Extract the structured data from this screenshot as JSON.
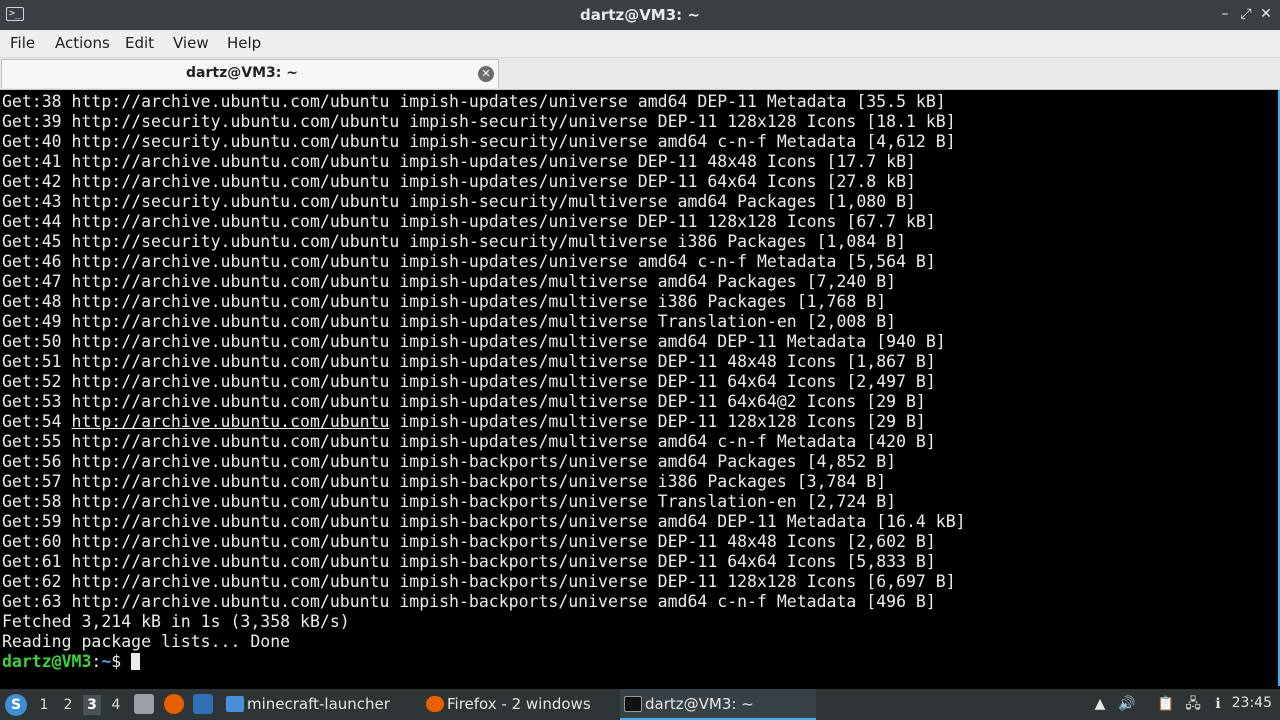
{
  "window": {
    "title": "dartz@VM3: ~",
    "app_icon_glyph": ">_",
    "minimize_glyph": "–",
    "maximize_glyph": "⤢",
    "close_glyph": "✕"
  },
  "menu": {
    "items": [
      "File",
      "Actions",
      "Edit",
      "View",
      "Help"
    ]
  },
  "tabs": [
    {
      "label": "dartz@VM3: ~",
      "close_glyph": "✕"
    }
  ],
  "terminal": {
    "lines": [
      {
        "pre": "Get:38 ",
        "url": "http://archive.ubuntu.com/ubuntu",
        "post": " impish-updates/universe amd64 DEP-11 Metadata [35.5 kB]"
      },
      {
        "pre": "Get:39 ",
        "url": "http://security.ubuntu.com/ubuntu",
        "post": " impish-security/universe DEP-11 128x128 Icons [18.1 kB]"
      },
      {
        "pre": "Get:40 ",
        "url": "http://security.ubuntu.com/ubuntu",
        "post": " impish-security/universe amd64 c-n-f Metadata [4,612 B]"
      },
      {
        "pre": "Get:41 ",
        "url": "http://archive.ubuntu.com/ubuntu",
        "post": " impish-updates/universe DEP-11 48x48 Icons [17.7 kB]"
      },
      {
        "pre": "Get:42 ",
        "url": "http://archive.ubuntu.com/ubuntu",
        "post": " impish-updates/universe DEP-11 64x64 Icons [27.8 kB]"
      },
      {
        "pre": "Get:43 ",
        "url": "http://security.ubuntu.com/ubuntu",
        "post": " impish-security/multiverse amd64 Packages [1,080 B]"
      },
      {
        "pre": "Get:44 ",
        "url": "http://archive.ubuntu.com/ubuntu",
        "post": " impish-updates/universe DEP-11 128x128 Icons [67.7 kB]"
      },
      {
        "pre": "Get:45 ",
        "url": "http://security.ubuntu.com/ubuntu",
        "post": " impish-security/multiverse i386 Packages [1,084 B]"
      },
      {
        "pre": "Get:46 ",
        "url": "http://archive.ubuntu.com/ubuntu",
        "post": " impish-updates/universe amd64 c-n-f Metadata [5,564 B]"
      },
      {
        "pre": "Get:47 ",
        "url": "http://archive.ubuntu.com/ubuntu",
        "post": " impish-updates/multiverse amd64 Packages [7,240 B]"
      },
      {
        "pre": "Get:48 ",
        "url": "http://archive.ubuntu.com/ubuntu",
        "post": " impish-updates/multiverse i386 Packages [1,768 B]"
      },
      {
        "pre": "Get:49 ",
        "url": "http://archive.ubuntu.com/ubuntu",
        "post": " impish-updates/multiverse Translation-en [2,008 B]"
      },
      {
        "pre": "Get:50 ",
        "url": "http://archive.ubuntu.com/ubuntu",
        "post": " impish-updates/multiverse amd64 DEP-11 Metadata [940 B]"
      },
      {
        "pre": "Get:51 ",
        "url": "http://archive.ubuntu.com/ubuntu",
        "post": " impish-updates/multiverse DEP-11 48x48 Icons [1,867 B]"
      },
      {
        "pre": "Get:52 ",
        "url": "http://archive.ubuntu.com/ubuntu",
        "post": " impish-updates/multiverse DEP-11 64x64 Icons [2,497 B]"
      },
      {
        "pre": "Get:53 ",
        "url": "http://archive.ubuntu.com/ubuntu",
        "post": " impish-updates/multiverse DEP-11 64x64@2 Icons [29 B]"
      },
      {
        "pre": "Get:54 ",
        "url": "http://archive.ubuntu.com/ubuntu",
        "post": " impish-updates/multiverse DEP-11 128x128 Icons [29 B]",
        "hovered": true
      },
      {
        "pre": "Get:55 ",
        "url": "http://archive.ubuntu.com/ubuntu",
        "post": " impish-updates/multiverse amd64 c-n-f Metadata [420 B]"
      },
      {
        "pre": "Get:56 ",
        "url": "http://archive.ubuntu.com/ubuntu",
        "post": " impish-backports/universe amd64 Packages [4,852 B]"
      },
      {
        "pre": "Get:57 ",
        "url": "http://archive.ubuntu.com/ubuntu",
        "post": " impish-backports/universe i386 Packages [3,784 B]"
      },
      {
        "pre": "Get:58 ",
        "url": "http://archive.ubuntu.com/ubuntu",
        "post": " impish-backports/universe Translation-en [2,724 B]"
      },
      {
        "pre": "Get:59 ",
        "url": "http://archive.ubuntu.com/ubuntu",
        "post": " impish-backports/universe amd64 DEP-11 Metadata [16.4 kB]"
      },
      {
        "pre": "Get:60 ",
        "url": "http://archive.ubuntu.com/ubuntu",
        "post": " impish-backports/universe DEP-11 48x48 Icons [2,602 B]"
      },
      {
        "pre": "Get:61 ",
        "url": "http://archive.ubuntu.com/ubuntu",
        "post": " impish-backports/universe DEP-11 64x64 Icons [5,833 B]"
      },
      {
        "pre": "Get:62 ",
        "url": "http://archive.ubuntu.com/ubuntu",
        "post": " impish-backports/universe DEP-11 128x128 Icons [6,697 B]"
      },
      {
        "pre": "Get:63 ",
        "url": "http://archive.ubuntu.com/ubuntu",
        "post": " impish-backports/universe amd64 c-n-f Metadata [496 B]"
      },
      {
        "pre": "Fetched 3,214 kB in 1s (3,358 kB/s)",
        "url": "",
        "post": ""
      },
      {
        "pre": "Reading package lists... Done",
        "url": "",
        "post": ""
      }
    ],
    "prompt": {
      "user_host": "dartz@VM3",
      "sep": ":",
      "dir": "~",
      "symbol": "$ "
    },
    "colors": {
      "background": "#000000",
      "text": "#ececec",
      "prompt_user": "#3dd13d",
      "prompt_dir": "#4da3ff"
    }
  },
  "taskbar": {
    "start_icon": "start-menu-icon",
    "workspaces": [
      "1",
      "2",
      "3",
      "4"
    ],
    "active_workspace": "3",
    "tasks": [
      {
        "label": "minecraft-launcher",
        "icon": "folder-icon",
        "active": false
      },
      {
        "label": "Firefox - 2 windows",
        "icon": "firefox-icon",
        "active": false
      },
      {
        "label": "dartz@VM3: ~",
        "icon": "terminal-icon",
        "active": true
      }
    ],
    "clock": "23:45",
    "accent": "#3daee9"
  }
}
